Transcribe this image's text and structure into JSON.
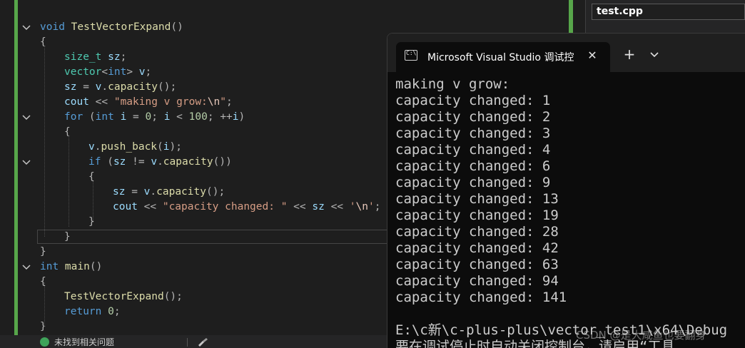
{
  "editor": {
    "code": [
      [
        [
          "kw",
          "void "
        ],
        [
          "fn",
          "TestVectorExpand"
        ],
        [
          "pun",
          "()"
        ]
      ],
      [
        [
          "pun",
          "{"
        ]
      ],
      [
        [
          "ty",
          "size_t"
        ],
        [
          "txt",
          " "
        ],
        [
          "var",
          "sz"
        ],
        [
          "pun",
          ";"
        ]
      ],
      [
        [
          "ty",
          "vector"
        ],
        [
          "pun",
          "<"
        ],
        [
          "kw",
          "int"
        ],
        [
          "pun",
          "> "
        ],
        [
          "var",
          "v"
        ],
        [
          "pun",
          ";"
        ]
      ],
      [
        [
          "var",
          "sz"
        ],
        [
          "pun",
          " = "
        ],
        [
          "var",
          "v"
        ],
        [
          "pun",
          "."
        ],
        [
          "fn",
          "capacity"
        ],
        [
          "pun",
          "();"
        ]
      ],
      [
        [
          "var",
          "cout"
        ],
        [
          "pun",
          " << "
        ],
        [
          "str",
          "\"making v grow:"
        ],
        [
          "esc",
          "\\n"
        ],
        [
          "str",
          "\""
        ],
        [
          "pun",
          ";"
        ]
      ],
      [
        [
          "kw",
          "for "
        ],
        [
          "pun",
          "("
        ],
        [
          "kw",
          "int "
        ],
        [
          "var",
          "i"
        ],
        [
          "pun",
          " = "
        ],
        [
          "num",
          "0"
        ],
        [
          "pun",
          "; "
        ],
        [
          "var",
          "i"
        ],
        [
          "pun",
          " < "
        ],
        [
          "num",
          "100"
        ],
        [
          "pun",
          "; ++"
        ],
        [
          "var",
          "i"
        ],
        [
          "pun",
          ")"
        ]
      ],
      [
        [
          "pun",
          "{"
        ]
      ],
      [
        [
          "var",
          "v"
        ],
        [
          "pun",
          "."
        ],
        [
          "fn",
          "push_back"
        ],
        [
          "pun",
          "("
        ],
        [
          "var",
          "i"
        ],
        [
          "pun",
          ");"
        ]
      ],
      [
        [
          "kw",
          "if "
        ],
        [
          "pun",
          "("
        ],
        [
          "var",
          "sz"
        ],
        [
          "pun",
          " != "
        ],
        [
          "var",
          "v"
        ],
        [
          "pun",
          "."
        ],
        [
          "fn",
          "capacity"
        ],
        [
          "pun",
          "())"
        ]
      ],
      [
        [
          "pun",
          "{"
        ]
      ],
      [
        [
          "var",
          "sz"
        ],
        [
          "pun",
          " = "
        ],
        [
          "var",
          "v"
        ],
        [
          "pun",
          "."
        ],
        [
          "fn",
          "capacity"
        ],
        [
          "pun",
          "();"
        ]
      ],
      [
        [
          "var",
          "cout"
        ],
        [
          "pun",
          " << "
        ],
        [
          "str",
          "\"capacity changed: \""
        ],
        [
          "pun",
          " << "
        ],
        [
          "var",
          "sz"
        ],
        [
          "pun",
          " << "
        ],
        [
          "str",
          "'"
        ],
        [
          "esc",
          "\\n"
        ],
        [
          "str",
          "'"
        ],
        [
          "pun",
          ";"
        ]
      ],
      [
        [
          "pun",
          "}"
        ]
      ],
      [
        [
          "pun",
          "}"
        ]
      ],
      [
        [
          "pun",
          "}"
        ]
      ],
      [
        [
          "kw",
          "int "
        ],
        [
          "fn",
          "main"
        ],
        [
          "pun",
          "()"
        ]
      ],
      [
        [
          "pun",
          "{"
        ]
      ],
      [
        [
          "fn",
          "TestVectorExpand"
        ],
        [
          "pun",
          "();"
        ]
      ],
      [
        [
          "kw",
          "return "
        ],
        [
          "num",
          "0"
        ],
        [
          "pun",
          ";"
        ]
      ],
      [
        [
          "pun",
          "}"
        ]
      ]
    ],
    "status_text": "未找到相关问题"
  },
  "file_tab": {
    "label": "test.cpp"
  },
  "terminal": {
    "tab_title": "Microsoft Visual Studio 调试控",
    "tab_icon_text": "C:\\",
    "close_glyph": "✕",
    "new_tab_glyph": "+",
    "output_lines": [
      "making v grow:",
      "capacity changed: 1",
      "capacity changed: 2",
      "capacity changed: 3",
      "capacity changed: 4",
      "capacity changed: 6",
      "capacity changed: 9",
      "capacity changed: 13",
      "capacity changed: 19",
      "capacity changed: 28",
      "capacity changed: 42",
      "capacity changed: 63",
      "capacity changed: 94",
      "capacity changed: 141",
      "",
      "E:\\c新\\c-plus-plus\\vector_test1\\x64\\Debug",
      "要在调试停止时自动关闭控制台，请启用“工具"
    ],
    "watermark": "CSDN @是大咸鱼也要翻身"
  },
  "colors": {
    "keyword": "#569cd6",
    "function": "#dcdcaa",
    "type": "#4ec9b0",
    "variable": "#9cdcfe",
    "string": "#d69d85",
    "number": "#b5cea8",
    "change_bar": "#57a64a"
  },
  "icons": [
    "fold-chevron-icon",
    "terminal-icon",
    "close-icon",
    "plus-icon",
    "chevron-down-icon",
    "status-ok-icon",
    "brush-icon"
  ]
}
